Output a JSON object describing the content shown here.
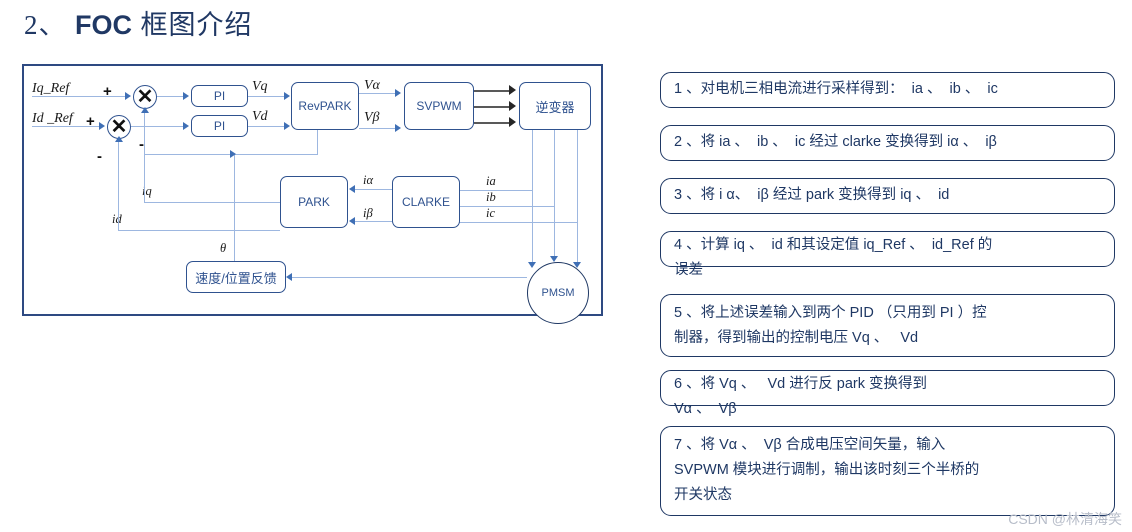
{
  "title": {
    "number": "2",
    "comma": "、",
    "foc": "FOC",
    "cn": "框图介绍",
    "full": "2、 FOC 框图介绍"
  },
  "diagram": {
    "blocks": [
      {
        "id": "pi-q",
        "label": "PI"
      },
      {
        "id": "pi-d",
        "label": "PI"
      },
      {
        "id": "revpark",
        "label": "RevPARK"
      },
      {
        "id": "svpwm",
        "label": "SVPWM"
      },
      {
        "id": "inverter",
        "label": "逆变器"
      },
      {
        "id": "park",
        "label": "PARK"
      },
      {
        "id": "clarke",
        "label": "CLARKE"
      },
      {
        "id": "feedback",
        "label": "速度/位置反馈"
      },
      {
        "id": "pmsm",
        "label": "PMSM"
      }
    ],
    "signals": {
      "iq_ref": "Iq_Ref",
      "id_ref": "Id _Ref",
      "vq": "Vq",
      "vd": "Vd",
      "valpha": "Vα",
      "vbeta": "Vβ",
      "ialpha": "iα",
      "ibeta": "iβ",
      "ia": "ia",
      "ib": "ib",
      "ic": "ic",
      "iq": "iq",
      "id": "id",
      "theta": "θ"
    },
    "signs": {
      "plus_q": "+",
      "plus_d": "+",
      "minus_q": "-",
      "minus_d": "-"
    }
  },
  "steps": [
    {
      "id": 1,
      "text": "1 、对电机三相电流进行采样得到：  ia 、  ib 、  ic"
    },
    {
      "id": 2,
      "text": "2 、将 ia 、  ib 、  ic 经过 clarke 变换得到 iα 、  iβ"
    },
    {
      "id": 3,
      "text": "3 、将 i α、  iβ 经过 park 变换得到 iq 、  id"
    },
    {
      "id": 4,
      "text": "4 、计算 iq 、  id 和其设定值 iq_Ref 、  id_Ref 的\n误差"
    },
    {
      "id": 5,
      "text": "5 、将上述误差输入到两个 PID （只用到 PI ）控\n制器，得到输出的控制电压 Vq 、   Vd"
    },
    {
      "id": 6,
      "text": "6 、将 Vq 、   Vd 进行反 park 变换得到\nVα 、  Vβ"
    },
    {
      "id": 7,
      "text": "7 、将 Vα 、  Vβ 合成电压空间矢量，输入\nSVPWM 模块进行调制，输出该时刻三个半桥的\n开关状态"
    }
  ],
  "watermark": "CSDN @林清海笑",
  "colors": {
    "text_navy": "#1f3864",
    "block_border": "#2f528f",
    "line_light": "#9db7e0",
    "line_dark": "#595959",
    "arrow": "#3f6fb5",
    "frame": "#2e4a82"
  }
}
